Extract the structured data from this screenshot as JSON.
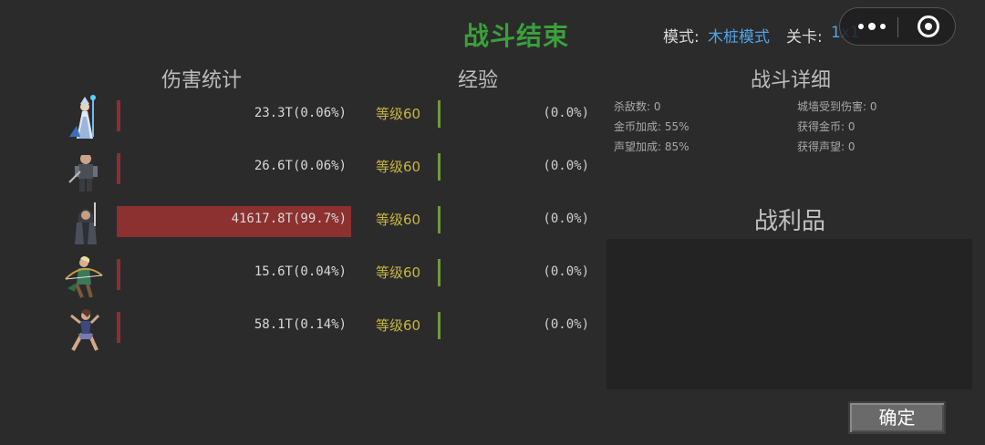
{
  "header": {
    "title": "战斗结束",
    "mode_label": "模式:",
    "mode_value": "木桩模式",
    "stage_label": "关卡:",
    "stage_value": "1x1"
  },
  "sections": {
    "damage": "伤害统计",
    "exp": "经验",
    "detail": "战斗详细",
    "loot": "战利品"
  },
  "heroes": [
    {
      "name_icon": "ice-mage-avatar",
      "damage": "23.3T(0.06%)",
      "damage_share": 0.0006,
      "level": "等级60",
      "exp": "(0.0%)"
    },
    {
      "name_icon": "armored-warrior-avatar",
      "damage": "26.6T(0.06%)",
      "damage_share": 0.0006,
      "level": "等级60",
      "exp": "(0.0%)"
    },
    {
      "name_icon": "hooded-rogue-avatar",
      "damage": "41617.8T(99.7%)",
      "damage_share": 0.997,
      "level": "等级60",
      "exp": "(0.0%)"
    },
    {
      "name_icon": "archer-avatar",
      "damage": "15.6T(0.04%)",
      "damage_share": 0.0004,
      "level": "等级60",
      "exp": "(0.0%)"
    },
    {
      "name_icon": "fighter-avatar",
      "damage": "58.1T(0.14%)",
      "damage_share": 0.0014,
      "level": "等级60",
      "exp": "(0.0%)"
    }
  ],
  "details": {
    "kills": "杀敌数: 0",
    "wall_damage": "城墙受到伤害: 0",
    "gold_bonus": "金币加成: 55%",
    "gold_gained": "获得金币: 0",
    "fame_bonus": "声望加成: 85%",
    "fame_gained": "获得声望: 0"
  },
  "confirm_label": "确定",
  "colors": {
    "title": "#3aa03a",
    "link": "#4fa3e8",
    "damage_bar": "#8c3030",
    "level": "#c8b640",
    "exp_bar": "#6f9a3a"
  }
}
